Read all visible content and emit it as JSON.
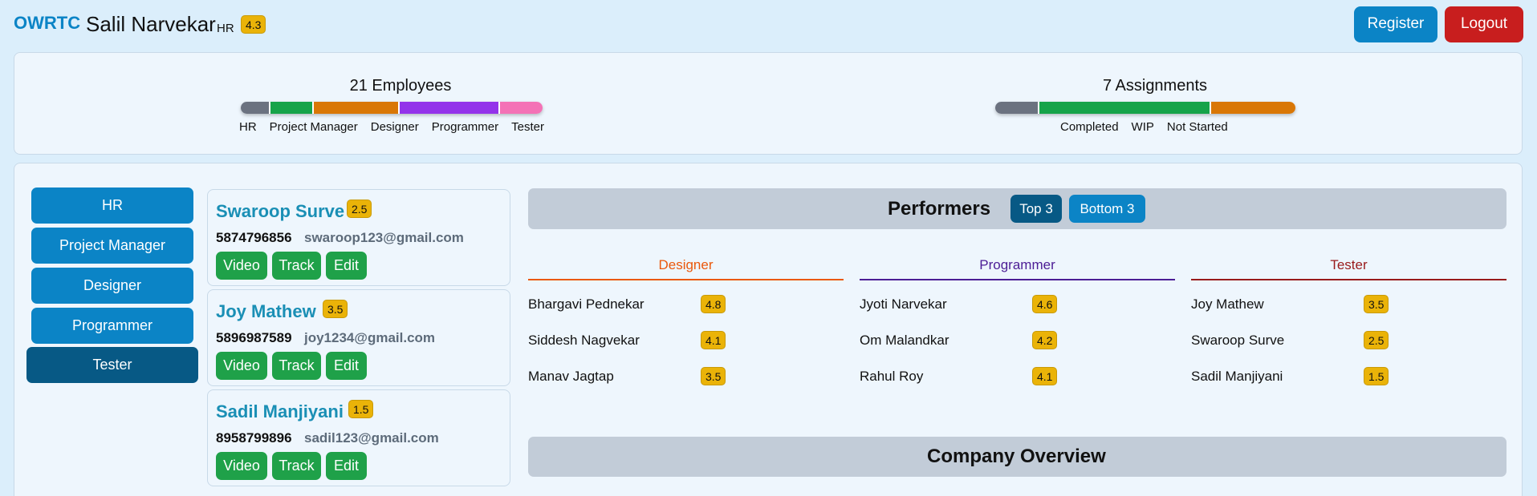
{
  "header": {
    "brand": "OWRTC",
    "user_name": "Salil Narvekar",
    "user_role": "HR",
    "user_rating": "4.3",
    "register_label": "Register",
    "logout_label": "Logout"
  },
  "stats": {
    "employees_title": "21 Employees",
    "employee_labels": [
      "HR",
      "Project Manager",
      "Designer",
      "Programmer",
      "Tester"
    ],
    "assignments_title": "7 Assignments",
    "assignment_labels": [
      "Completed",
      "WIP",
      "Not Started"
    ],
    "colors": {
      "gray": "#6b7280",
      "green": "#16a34a",
      "orange": "#d97706",
      "purple": "#9333ea",
      "pink": "#f472b6"
    }
  },
  "departments": [
    "HR",
    "Project Manager",
    "Designer",
    "Programmer",
    "Tester"
  ],
  "active_department": "Tester",
  "employees": [
    {
      "name": "Swaroop Surve",
      "rating": "2.5",
      "phone": "5874796856",
      "email": "swaroop123@gmail.com"
    },
    {
      "name": "Joy Mathew",
      "rating": "3.5",
      "phone": "5896987589",
      "email": "joy1234@gmail.com"
    },
    {
      "name": "Sadil Manjiyani",
      "rating": "1.5",
      "phone": "8958799896",
      "email": "sadil123@gmail.com"
    }
  ],
  "employee_actions": {
    "video": "Video",
    "track": "Track",
    "edit": "Edit"
  },
  "performers": {
    "title": "Performers",
    "top_label": "Top 3",
    "bottom_label": "Bottom 3",
    "columns": [
      {
        "title": "Designer",
        "color": "#ea580c",
        "rows": [
          {
            "name": "Bhargavi Pednekar",
            "rating": "4.8"
          },
          {
            "name": "Siddesh Nagvekar",
            "rating": "4.1"
          },
          {
            "name": "Manav Jagtap",
            "rating": "3.5"
          }
        ]
      },
      {
        "title": "Programmer",
        "color": "#4c1d95",
        "rows": [
          {
            "name": "Jyoti Narvekar",
            "rating": "4.6"
          },
          {
            "name": "Om Malandkar",
            "rating": "4.2"
          },
          {
            "name": "Rahul Roy",
            "rating": "4.1"
          }
        ]
      },
      {
        "title": "Tester",
        "color": "#991b1b",
        "rows": [
          {
            "name": "Joy Mathew",
            "rating": "3.5"
          },
          {
            "name": "Swaroop Surve",
            "rating": "2.5"
          },
          {
            "name": "Sadil Manjiyani",
            "rating": "1.5"
          }
        ]
      }
    ]
  },
  "overview": {
    "title": "Company Overview"
  }
}
